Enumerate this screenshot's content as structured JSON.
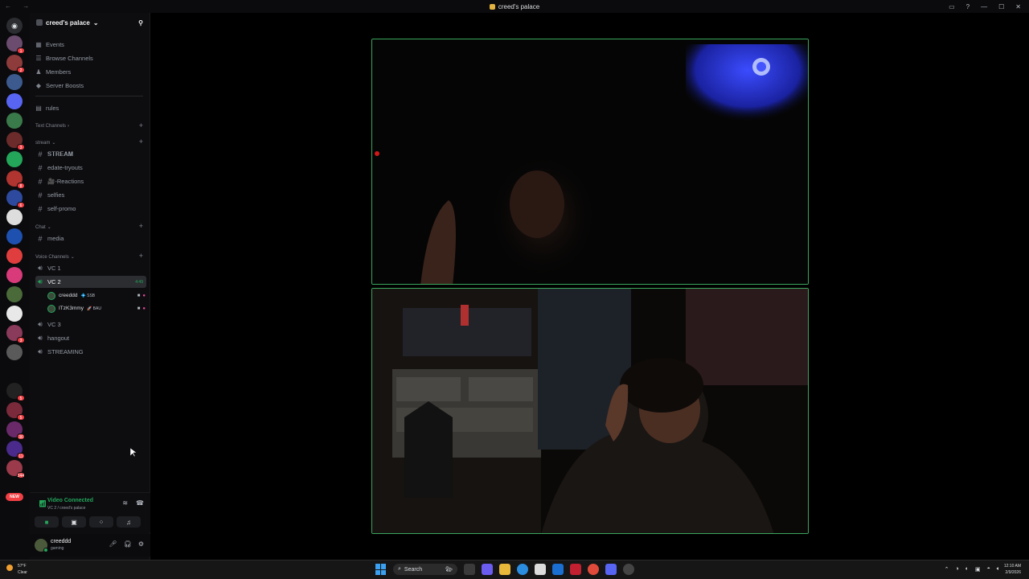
{
  "window": {
    "title": "creed's palace"
  },
  "guild": {
    "name": "creed's palace"
  },
  "nav": [
    {
      "label": "Events",
      "icon": "calendar-icon"
    },
    {
      "label": "Browse Channels",
      "icon": "list-icon"
    },
    {
      "label": "Members",
      "icon": "members-icon"
    },
    {
      "label": "Server Boosts",
      "icon": "boost-icon"
    }
  ],
  "rules_channel": "rules",
  "categories": {
    "text": "Text Channels",
    "stream": "stream",
    "chat": "Chat",
    "voice": "Voice Channels"
  },
  "stream_channels": [
    {
      "label": "𝐒𝐓𝐑𝐄𝐀𝐌"
    },
    {
      "label": "edate-tryouts"
    },
    {
      "label": "🎥-Reactions"
    },
    {
      "label": "selfies"
    },
    {
      "label": "self-promo"
    }
  ],
  "chat_channels": [
    {
      "label": "media"
    }
  ],
  "voice_channels": {
    "vc1": "VC 1",
    "vc2": "VC 2",
    "vc2_timer": "4:49",
    "vc3": "VC 3",
    "hangout": "hangout",
    "streaming": "STREAMING"
  },
  "voice_users": [
    {
      "name": "creeddd",
      "tag": "💠 SSB"
    },
    {
      "name": "ITzK3mmy",
      "tag": "🚀 BAU"
    }
  ],
  "voice_panel": {
    "status": "Video Connected",
    "sub": "VC 2 / creed's palace"
  },
  "user": {
    "name": "creeddd",
    "status": "gaming"
  },
  "server_badges": [
    "1",
    "2",
    "3",
    "8",
    "6",
    "3",
    "5",
    "5",
    "36",
    "11",
    "244"
  ],
  "new_badge": "NEW",
  "taskbar": {
    "weather_temp": "57°F",
    "weather_desc": "Clear",
    "search_label": "Search",
    "time": "12:10 AM",
    "date": "2/9/2026"
  }
}
